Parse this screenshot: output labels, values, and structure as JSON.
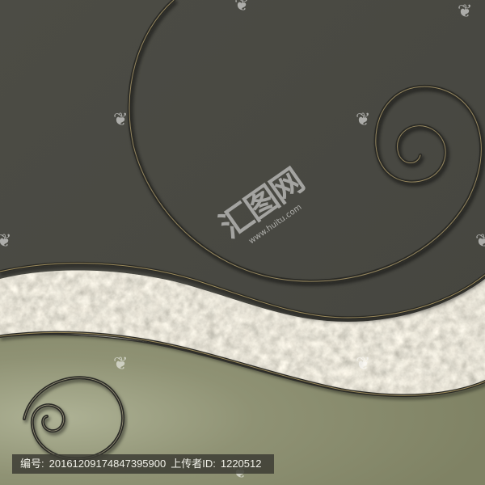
{
  "watermark": {
    "logo_text": "汇图网",
    "site_text": "www.huitu.com",
    "small_glyph": "❦"
  },
  "caption": {
    "id_label": "编号:",
    "id_value": "20161209174847395900",
    "uploader_label": "上传者ID:",
    "uploader_value": "1220512"
  },
  "colors": {
    "upper_panel": "#4a4a43",
    "lower_panel": "#8c8f71",
    "stone": "#7d7a6c",
    "metal": "#2f2f29",
    "metal_highlight": "#b9a46b"
  }
}
